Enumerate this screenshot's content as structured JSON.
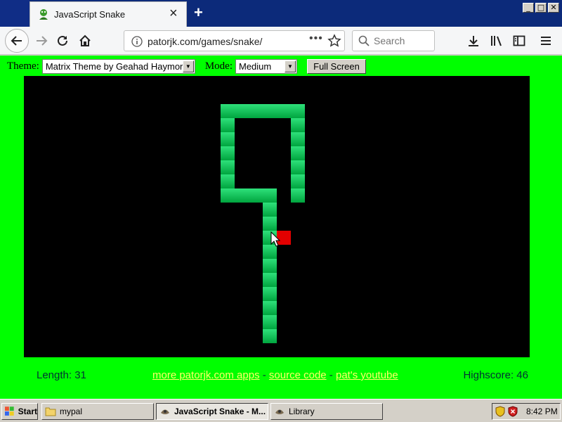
{
  "browser": {
    "tab_title": "JavaScript Snake",
    "new_tab_label": "+",
    "window_controls": [
      "_",
      "□",
      "✕"
    ],
    "url": "patorjk.com/games/snake/",
    "url_more": "•••",
    "search_placeholder": "Search"
  },
  "game": {
    "theme_label": "Theme:",
    "theme_value": "Matrix Theme by Geahad Haymor",
    "mode_label": "Mode:",
    "mode_value": "Medium",
    "fullscreen_label": "Full Screen",
    "length_text": "Length: 31",
    "link_more": "more patorjk.com apps",
    "link_source": "source code",
    "link_youtube": "pat's youtube",
    "link_separator": " - ",
    "highscore_text": "Highscore: 46",
    "colors": {
      "background": "#00ff00",
      "board": "#000000",
      "snake": "#22cc66",
      "food": "#e30000",
      "link": "#ffff66"
    }
  },
  "taskbar": {
    "start_label": "Start",
    "tasks": [
      "mypal",
      "JavaScript Snake - M...",
      "Library"
    ],
    "clock": "8:42 PM"
  }
}
